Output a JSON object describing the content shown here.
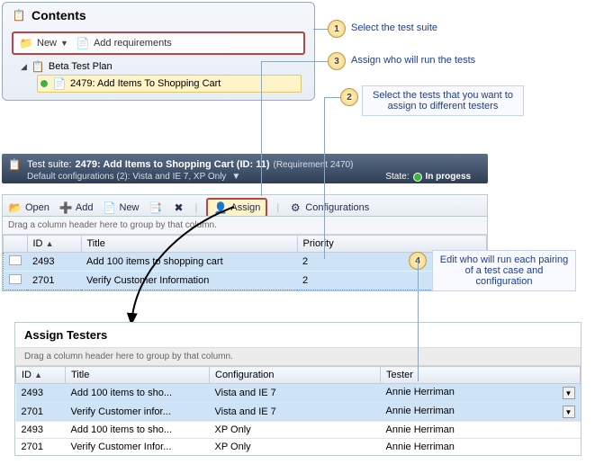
{
  "contents": {
    "title": "Contents",
    "new_label": "New",
    "add_req_label": "Add requirements",
    "tree": {
      "plan": "Beta Test Plan",
      "item": "2479: Add Items To Shopping Cart"
    }
  },
  "suite": {
    "prefix": "Test suite:",
    "title": "2479: Add Items to Shopping Cart (ID: 11)",
    "req": "(Requirement 2470)",
    "sub": "Default configurations (2): Vista and IE 7, XP Only",
    "state_label": "State:",
    "state_value": "In progess"
  },
  "tb2": {
    "open": "Open",
    "add": "Add",
    "new": "New",
    "assign": "Assign",
    "configs": "Configurations"
  },
  "grid": {
    "drag": "Drag a column header here to group by that column.",
    "cols": {
      "id": "ID",
      "title": "Title",
      "priority": "Priority"
    },
    "rows": [
      {
        "id": "2493",
        "title": "Add 100 items to shopping cart",
        "priority": "2"
      },
      {
        "id": "2701",
        "title": "Verify Customer Information",
        "priority": "2"
      }
    ]
  },
  "assign": {
    "title": "Assign Testers",
    "drag": "Drag a column header here to group by that column.",
    "cols": {
      "id": "ID",
      "title": "Title",
      "config": "Configuration",
      "tester": "Tester"
    },
    "rows": [
      {
        "id": "2493",
        "title": "Add 100 items to sho...",
        "config": "Vista and IE 7",
        "tester": "Annie Herriman",
        "sel": true,
        "dd": true
      },
      {
        "id": "2701",
        "title": "Verify Customer infor...",
        "config": "Vista and IE 7",
        "tester": "Annie Herriman",
        "sel": true,
        "dd": true
      },
      {
        "id": "2493",
        "title": "Add 100 items to sho...",
        "config": "XP Only",
        "tester": "Annie Herriman"
      },
      {
        "id": "2701",
        "title": "Verify Customer Infor...",
        "config": "XP Only",
        "tester": "Annie Herriman"
      }
    ]
  },
  "callouts": {
    "c1": "Select the test suite",
    "c2": "Select the tests that you want to assign to different testers",
    "c3": "Assign who will run the tests",
    "c4": "Edit who will run each pairing of a test case and configuration"
  }
}
